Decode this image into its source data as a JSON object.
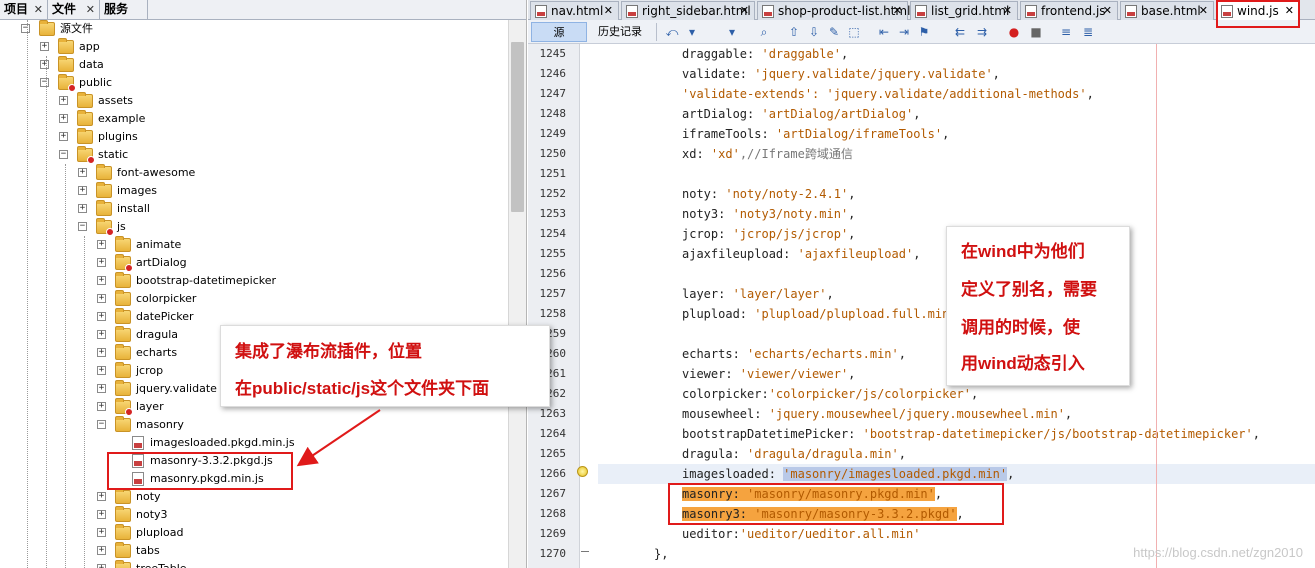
{
  "left_tabs": [
    {
      "label": "项目",
      "close": "✕"
    },
    {
      "label": "文件",
      "close": "✕"
    },
    {
      "label": "服务",
      "close": ""
    }
  ],
  "tree": [
    {
      "label": "源文件",
      "level": 0,
      "expanded": true,
      "kind": "root"
    },
    {
      "label": "app",
      "level": 1,
      "expanded": false,
      "kind": "folder"
    },
    {
      "label": "data",
      "level": 1,
      "expanded": false,
      "kind": "folder"
    },
    {
      "label": "public",
      "level": 1,
      "expanded": true,
      "kind": "folder",
      "badge": true
    },
    {
      "label": "assets",
      "level": 2,
      "expanded": false,
      "kind": "folder"
    },
    {
      "label": "example",
      "level": 2,
      "expanded": false,
      "kind": "folder"
    },
    {
      "label": "plugins",
      "level": 2,
      "expanded": false,
      "kind": "folder"
    },
    {
      "label": "static",
      "level": 2,
      "expanded": true,
      "kind": "folder",
      "badge": true
    },
    {
      "label": "font-awesome",
      "level": 3,
      "expanded": false,
      "kind": "folder"
    },
    {
      "label": "images",
      "level": 3,
      "expanded": false,
      "kind": "folder"
    },
    {
      "label": "install",
      "level": 3,
      "expanded": false,
      "kind": "folder"
    },
    {
      "label": "js",
      "level": 3,
      "expanded": true,
      "kind": "folder",
      "badge": true
    },
    {
      "label": "animate",
      "level": 4,
      "expanded": false,
      "kind": "folder"
    },
    {
      "label": "artDialog",
      "level": 4,
      "expanded": false,
      "kind": "folder",
      "badge": true
    },
    {
      "label": "bootstrap-datetimepicker",
      "level": 4,
      "expanded": false,
      "kind": "folder"
    },
    {
      "label": "colorpicker",
      "level": 4,
      "expanded": false,
      "kind": "folder"
    },
    {
      "label": "datePicker",
      "level": 4,
      "expanded": false,
      "kind": "folder"
    },
    {
      "label": "dragula",
      "level": 4,
      "expanded": false,
      "kind": "folder"
    },
    {
      "label": "echarts",
      "level": 4,
      "expanded": false,
      "kind": "folder"
    },
    {
      "label": "jcrop",
      "level": 4,
      "expanded": false,
      "kind": "folder"
    },
    {
      "label": "jquery.validate",
      "level": 4,
      "expanded": false,
      "kind": "folder"
    },
    {
      "label": "layer",
      "level": 4,
      "expanded": false,
      "kind": "folder",
      "badge": true
    },
    {
      "label": "masonry",
      "level": 4,
      "expanded": true,
      "kind": "folder"
    },
    {
      "label": "imagesloaded.pkgd.min.js",
      "level": 5,
      "kind": "file"
    },
    {
      "label": "masonry-3.3.2.pkgd.js",
      "level": 5,
      "kind": "file"
    },
    {
      "label": "masonry.pkgd.min.js",
      "level": 5,
      "kind": "file"
    },
    {
      "label": "noty",
      "level": 4,
      "expanded": false,
      "kind": "folder"
    },
    {
      "label": "noty3",
      "level": 4,
      "expanded": false,
      "kind": "folder"
    },
    {
      "label": "plupload",
      "level": 4,
      "expanded": false,
      "kind": "folder"
    },
    {
      "label": "tabs",
      "level": 4,
      "expanded": false,
      "kind": "folder"
    },
    {
      "label": "treeTable",
      "level": 4,
      "expanded": false,
      "kind": "folder"
    }
  ],
  "editor_tabs": [
    {
      "label": "nav.html",
      "active": false
    },
    {
      "label": "right_sidebar.html",
      "active": false
    },
    {
      "label": "shop-product-list.html",
      "active": false
    },
    {
      "label": "list_grid.html",
      "active": false
    },
    {
      "label": "frontend.js",
      "active": false
    },
    {
      "label": "base.html",
      "active": false
    },
    {
      "label": "wind.js",
      "active": true
    }
  ],
  "toolbar": {
    "source_tab": "源",
    "history_tab": "历史记录",
    "icons": [
      "back-icon",
      "history-dropdown-icon",
      "forward-dropdown-icon",
      "find-icon",
      "find-prev-icon",
      "find-next-icon",
      "toggle-highlight-icon",
      "select-icon",
      "prev-bookmark-icon",
      "next-bookmark-icon",
      "toggle-bookmark-icon",
      "shift-left-icon",
      "shift-right-icon",
      "record-macro-icon",
      "stop-macro-icon",
      "comment-icon",
      "uncomment-icon"
    ]
  },
  "code_lines": [
    {
      "n": "1245",
      "text": "'draggable'",
      "key": "draggable: ",
      "tail": ","
    },
    {
      "n": "1246",
      "key": "validate: ",
      "text": "'jquery.validate/jquery.validate'",
      "tail": ","
    },
    {
      "n": "1247",
      "key": "",
      "text": "'validate-extends': 'jquery.validate/additional-methods'",
      "tail": ","
    },
    {
      "n": "1248",
      "key": "artDialog: ",
      "text": "'artDialog/artDialog'",
      "tail": ","
    },
    {
      "n": "1249",
      "key": "iframeTools: ",
      "text": "'artDialog/iframeTools'",
      "tail": ","
    },
    {
      "n": "1250",
      "key": "xd: ",
      "text": "'xd'",
      "tail": ",//Iframe跨域通信"
    },
    {
      "n": "1251",
      "key": "",
      "text": "",
      "tail": ""
    },
    {
      "n": "1252",
      "key": "noty: ",
      "text": "'noty/noty-2.4.1'",
      "tail": ","
    },
    {
      "n": "1253",
      "key": "noty3: ",
      "text": "'noty3/noty.min'",
      "tail": ","
    },
    {
      "n": "1254",
      "key": "jcrop: ",
      "text": "'jcrop/js/jcrop'",
      "tail": ","
    },
    {
      "n": "1255",
      "key": "ajaxfileupload: ",
      "text": "'ajaxfileupload'",
      "tail": ","
    },
    {
      "n": "1256",
      "key": "",
      "text": "",
      "tail": ""
    },
    {
      "n": "1257",
      "key": "layer: ",
      "text": "'layer/layer'",
      "tail": ","
    },
    {
      "n": "1258",
      "key": "plupload: ",
      "text": "'plupload/plupload.full.min'",
      "tail": ","
    },
    {
      "n": "1259",
      "key": "",
      "text": "",
      "tail": ""
    },
    {
      "n": "1260",
      "key": "echarts: ",
      "text": "'echarts/echarts.min'",
      "tail": ","
    },
    {
      "n": "1261",
      "key": "viewer: ",
      "text": "'viewer/viewer'",
      "tail": ","
    },
    {
      "n": "1262",
      "key": "colorpicker:",
      "text": "'colorpicker/js/colorpicker'",
      "tail": ","
    },
    {
      "n": "1263",
      "key": "mousewheel: ",
      "text": "'jquery.mousewheel/jquery.mousewheel.min'",
      "tail": ","
    },
    {
      "n": "1264",
      "key": "bootstrapDatetimePicker: ",
      "text": "'bootstrap-datetimepicker/js/bootstrap-datetimepicker'",
      "tail": ","
    },
    {
      "n": "1265",
      "key": "dragula: ",
      "text": "'dragula/dragula.min'",
      "tail": ","
    },
    {
      "n": "1266",
      "key": "imagesloaded: ",
      "text": "'masonry/imagesloaded.pkgd.min'",
      "tail": ","
    },
    {
      "n": "1267",
      "key": "masonry: ",
      "text": "'masonry/masonry.pkgd.min'",
      "tail": ","
    },
    {
      "n": "1268",
      "key": "masonry3: ",
      "text": "'masonry/masonry-3.3.2.pkgd'",
      "tail": ","
    },
    {
      "n": "1269",
      "key": "ueditor:",
      "text": "'ueditor/ueditor.all.min'",
      "tail": ""
    },
    {
      "n": "1270",
      "key": "},",
      "text": "",
      "tail": ""
    }
  ],
  "callout_left": {
    "line1": "集成了瀑布流插件，位置",
    "line2": "在public/static/js这个文件夹下面"
  },
  "callout_right": {
    "line1": "在wind中为他们",
    "line2": "定义了别名，需要",
    "line3": "调用的时候，使",
    "line4": "用wind动态引入"
  },
  "watermark": "https://blog.csdn.net/zgn2010",
  "colors": {
    "annotation_red": "#e01a1a",
    "match_highlight": "#f5a33f",
    "string": "#b25a00"
  }
}
